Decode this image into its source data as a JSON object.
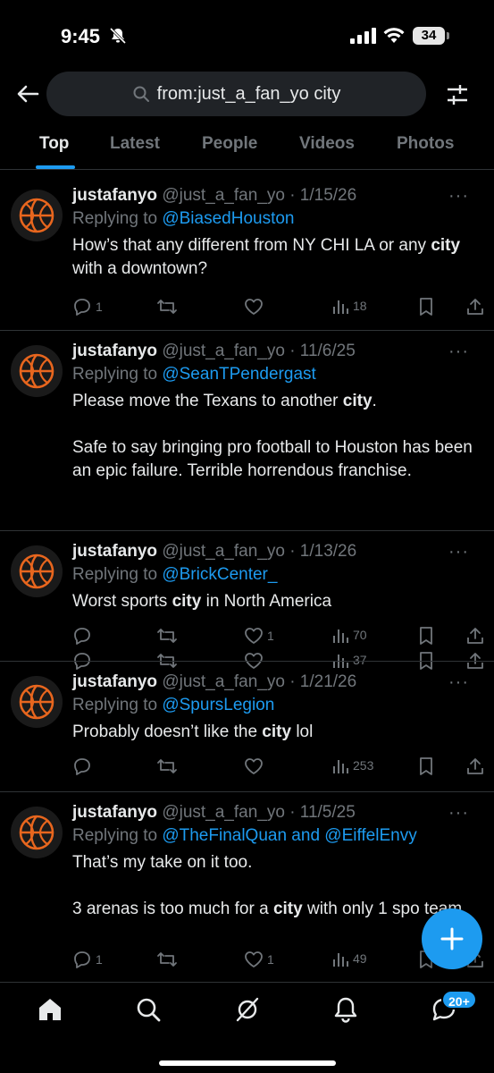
{
  "status_bar": {
    "time": "9:45",
    "battery": "34"
  },
  "search": {
    "query": "from:just_a_fan_yo city"
  },
  "tabs": [
    {
      "label": "Top",
      "active": true
    },
    {
      "label": "Latest",
      "active": false
    },
    {
      "label": "People",
      "active": false
    },
    {
      "label": "Videos",
      "active": false
    },
    {
      "label": "Photos",
      "active": false
    }
  ],
  "tweets": [
    {
      "name": "justafanyo",
      "meta": "@just_a_fan_yo · 1/15/26",
      "reply_prefix": "Replying to ",
      "reply_to": "@BiasedHouston",
      "text_html": "How’s that any different from NY CHI LA or any <b>city</b> with a downtown?",
      "replies": "1",
      "reposts": "",
      "likes": "",
      "views": "18"
    },
    {
      "name": "justafanyo",
      "meta": "@just_a_fan_yo · 11/6/25",
      "reply_prefix": "Replying to ",
      "reply_to": "@SeanTPendergast",
      "text_html": "<p>Please move the Texans to another <b>city</b>.</p><p>Safe to say bringing pro football to Houston has been an epic failure. Terrible horrendous franchise.</p>",
      "replies": "",
      "reposts": "",
      "likes": "",
      "views": "37"
    },
    {
      "name": "justafanyo",
      "meta": "@just_a_fan_yo · 1/13/26",
      "reply_prefix": "Replying to ",
      "reply_to": "@BrickCenter_",
      "text_html": "Worst sports <b>city</b> in North America",
      "replies": "",
      "reposts": "",
      "likes": "1",
      "views": "70"
    },
    {
      "name": "justafanyo",
      "meta": "@just_a_fan_yo · 1/21/26",
      "reply_prefix": "Replying to ",
      "reply_to": "@SpursLegion",
      "text_html": "Probably doesn’t like the <b>city</b> lol",
      "replies": "",
      "reposts": "",
      "likes": "",
      "views": "253"
    },
    {
      "name": "justafanyo",
      "meta": "@just_a_fan_yo · 11/5/25",
      "reply_prefix": "Replying to ",
      "reply_to": "@TheFinalQuan and @EiffelEnvy",
      "text_html": "<p>That’s my take on it too.</p><p>3 arenas is too much for a <b>city</b> with only 1 spo team.</p>",
      "replies": "1",
      "reposts": "",
      "likes": "1",
      "views": "49"
    }
  ],
  "bottom_nav": {
    "messages_badge": "20+"
  },
  "colors": {
    "accent": "#1d9bf0",
    "text": "#e7e9ea",
    "muted": "#71767b",
    "divider": "#2f3336",
    "avatar_ball": "#e8661e"
  },
  "icons": [
    "back-arrow-icon",
    "search-icon",
    "filter-icon",
    "reply-icon",
    "repost-icon",
    "like-icon",
    "views-icon",
    "bookmark-icon",
    "share-icon",
    "compose-plus-icon",
    "home-icon",
    "explore-icon",
    "grok-icon",
    "notifications-icon",
    "messages-icon"
  ]
}
